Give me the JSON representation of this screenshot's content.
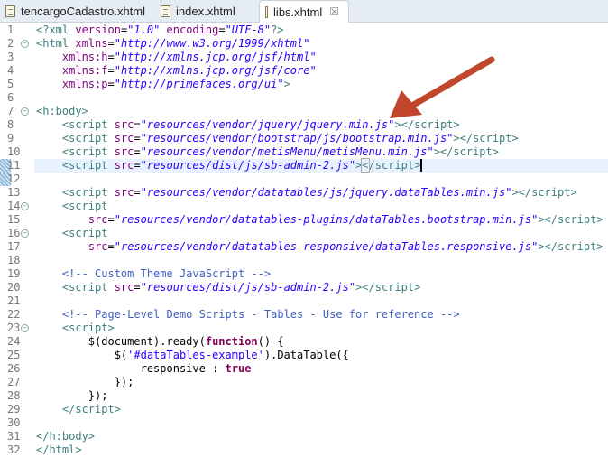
{
  "tabs": [
    {
      "label": "tencargoCadastro.xhtml",
      "active": false
    },
    {
      "label": "index.xhtml",
      "active": false
    },
    {
      "label": "libs.xhtml",
      "active": true,
      "close": "☒"
    }
  ],
  "editor": {
    "current_line": 11,
    "fold_lines": [
      2,
      7,
      14,
      16,
      23
    ],
    "lines": [
      [
        [
          "t",
          "<?xml "
        ],
        [
          "a",
          "version"
        ],
        [
          "p",
          "="
        ],
        [
          "v",
          "\"1.0\""
        ],
        [
          "p",
          " "
        ],
        [
          "a",
          "encoding"
        ],
        [
          "p",
          "="
        ],
        [
          "v",
          "\"UTF-8\""
        ],
        [
          "t",
          "?>"
        ]
      ],
      [
        [
          "t",
          "<html "
        ],
        [
          "a",
          "xmlns"
        ],
        [
          "p",
          "="
        ],
        [
          "v",
          "\"http://www.w3.org/1999/xhtml\""
        ]
      ],
      [
        [
          "p",
          "    "
        ],
        [
          "a",
          "xmlns:h"
        ],
        [
          "p",
          "="
        ],
        [
          "v",
          "\"http://xmlns.jcp.org/jsf/html\""
        ]
      ],
      [
        [
          "p",
          "    "
        ],
        [
          "a",
          "xmlns:f"
        ],
        [
          "p",
          "="
        ],
        [
          "v",
          "\"http://xmlns.jcp.org/jsf/core\""
        ]
      ],
      [
        [
          "p",
          "    "
        ],
        [
          "a",
          "xmlns:p"
        ],
        [
          "p",
          "="
        ],
        [
          "v",
          "\"http://primefaces.org/ui\""
        ],
        [
          "t",
          ">"
        ]
      ],
      [],
      [
        [
          "t",
          "<h:body>"
        ]
      ],
      [
        [
          "p",
          "    "
        ],
        [
          "t",
          "<script "
        ],
        [
          "a",
          "src"
        ],
        [
          "p",
          "="
        ],
        [
          "v",
          "\"resources/vendor/jquery/jquery.min.js\""
        ],
        [
          "t",
          "></script>"
        ]
      ],
      [
        [
          "p",
          "    "
        ],
        [
          "t",
          "<script "
        ],
        [
          "a",
          "src"
        ],
        [
          "p",
          "="
        ],
        [
          "v",
          "\"resources/vendor/bootstrap/js/bootstrap.min.js\""
        ],
        [
          "t",
          "></script>"
        ]
      ],
      [
        [
          "p",
          "    "
        ],
        [
          "t",
          "<script "
        ],
        [
          "a",
          "src"
        ],
        [
          "p",
          "="
        ],
        [
          "v",
          "\"resources/vendor/metisMenu/metisMenu.min.js\""
        ],
        [
          "t",
          "></script>"
        ]
      ],
      [
        [
          "p",
          "    "
        ],
        [
          "t",
          "<script "
        ],
        [
          "a",
          "src"
        ],
        [
          "p",
          "="
        ],
        [
          "v",
          "\"resources/dist/js/sb-admin-2.js\""
        ],
        [
          "t",
          "></script>"
        ]
      ],
      [],
      [
        [
          "p",
          "    "
        ],
        [
          "t",
          "<script "
        ],
        [
          "a",
          "src"
        ],
        [
          "p",
          "="
        ],
        [
          "v",
          "\"resources/vendor/datatables/js/jquery.dataTables.min.js\""
        ],
        [
          "t",
          "></script>"
        ]
      ],
      [
        [
          "p",
          "    "
        ],
        [
          "t",
          "<script"
        ]
      ],
      [
        [
          "p",
          "        "
        ],
        [
          "a",
          "src"
        ],
        [
          "p",
          "="
        ],
        [
          "v",
          "\"resources/vendor/datatables-plugins/dataTables.bootstrap.min.js\""
        ],
        [
          "t",
          "></script>"
        ]
      ],
      [
        [
          "p",
          "    "
        ],
        [
          "t",
          "<script"
        ]
      ],
      [
        [
          "p",
          "        "
        ],
        [
          "a",
          "src"
        ],
        [
          "p",
          "="
        ],
        [
          "v",
          "\"resources/vendor/datatables-responsive/dataTables.responsive.js\""
        ],
        [
          "t",
          "></script>"
        ]
      ],
      [],
      [
        [
          "p",
          "    "
        ],
        [
          "c",
          "<!-- Custom Theme JavaScript -->"
        ]
      ],
      [
        [
          "p",
          "    "
        ],
        [
          "t",
          "<script "
        ],
        [
          "a",
          "src"
        ],
        [
          "p",
          "="
        ],
        [
          "v",
          "\"resources/dist/js/sb-admin-2.js\""
        ],
        [
          "t",
          "></script>"
        ]
      ],
      [],
      [
        [
          "p",
          "    "
        ],
        [
          "c",
          "<!-- Page-Level Demo Scripts - Tables - Use for reference -->"
        ]
      ],
      [
        [
          "p",
          "    "
        ],
        [
          "t",
          "<script>"
        ]
      ],
      [
        [
          "p",
          "        $(document).ready("
        ],
        [
          "k",
          "function"
        ],
        [
          "p",
          "() {"
        ]
      ],
      [
        [
          "p",
          "            $("
        ],
        [
          "s",
          "'#dataTables-example'"
        ],
        [
          "p",
          ").DataTable({"
        ]
      ],
      [
        [
          "p",
          "                responsive : "
        ],
        [
          "k",
          "true"
        ]
      ],
      [
        [
          "p",
          "            });"
        ]
      ],
      [
        [
          "p",
          "        });"
        ]
      ],
      [
        [
          "p",
          "    "
        ],
        [
          "t",
          "</script>"
        ]
      ],
      [],
      [
        [
          "t",
          "</h:body>"
        ]
      ],
      [
        [
          "t",
          "</html>"
        ]
      ]
    ]
  },
  "annotation": {
    "arrow_color": "#c0462c"
  }
}
